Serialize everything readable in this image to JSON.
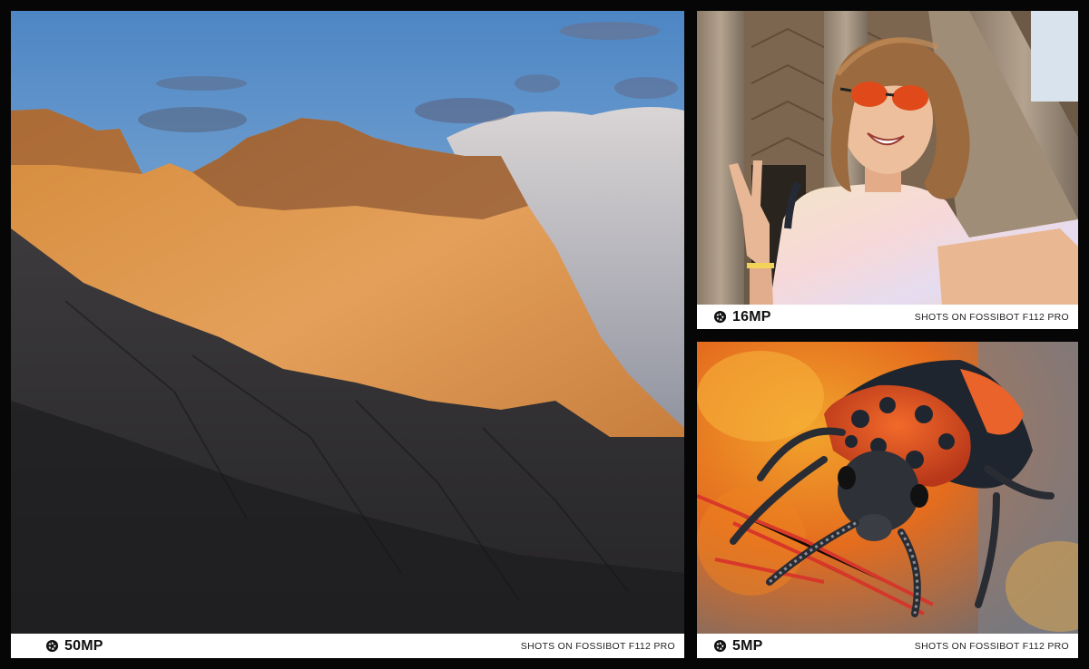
{
  "panels": [
    {
      "megapixels": "50MP",
      "caption": "SHOTS ON FOSSIBOT F112 PRO",
      "icon": "aperture-icon",
      "subject": "mountain"
    },
    {
      "megapixels": "16MP",
      "caption": "SHOTS ON FOSSIBOT F112 PRO",
      "icon": "aperture-icon",
      "subject": "selfie"
    },
    {
      "megapixels": "5MP",
      "caption": "SHOTS ON FOSSIBOT F112 PRO",
      "icon": "aperture-icon",
      "subject": "beetle"
    }
  ],
  "colors": {
    "background": "#060606",
    "caption_bar": "#ffffff",
    "caption_text": "#111111"
  }
}
